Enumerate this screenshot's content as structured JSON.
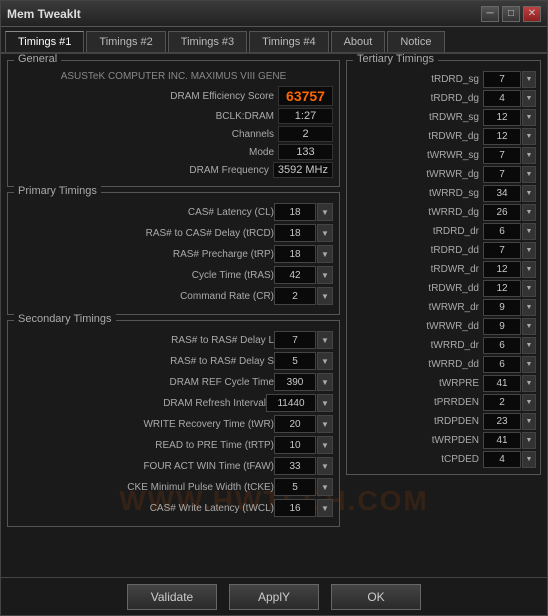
{
  "window": {
    "title": "Mem TweakIt",
    "buttons": {
      "minimize": "─",
      "maximize": "□",
      "close": "✕"
    }
  },
  "tabs": [
    {
      "label": "Timings #1",
      "active": true
    },
    {
      "label": "Timings #2",
      "active": false
    },
    {
      "label": "Timings #3",
      "active": false
    },
    {
      "label": "Timings #4",
      "active": false
    },
    {
      "label": "About",
      "active": false
    },
    {
      "label": "Notice",
      "active": false
    }
  ],
  "general": {
    "label": "General",
    "board": "ASUSTeK COMPUTER INC. MAXIMUS VIII GENE",
    "dram_score_label": "DRAM Efficiency Score",
    "dram_score": "63757",
    "bclk_label": "BCLK:DRAM",
    "bclk_value": "1:27",
    "channels_label": "Channels",
    "channels_value": "2",
    "mode_label": "Mode",
    "mode_value": "133",
    "freq_label": "DRAM Frequency",
    "freq_value": "3592 MHz"
  },
  "primary": {
    "label": "Primary Timings",
    "rows": [
      {
        "label": "CAS# Latency (CL)",
        "value": "18"
      },
      {
        "label": "RAS# to CAS# Delay (tRCD)",
        "value": "18"
      },
      {
        "label": "RAS# Precharge (tRP)",
        "value": "18"
      },
      {
        "label": "Cycle Time (tRAS)",
        "value": "42"
      },
      {
        "label": "Command Rate (CR)",
        "value": "2"
      }
    ]
  },
  "secondary": {
    "label": "Secondary Timings",
    "rows": [
      {
        "label": "RAS# to RAS# Delay L",
        "value": "7"
      },
      {
        "label": "RAS# to RAS# Delay S",
        "value": "5"
      },
      {
        "label": "DRAM REF Cycle Time",
        "value": "390"
      },
      {
        "label": "DRAM Refresh Interval",
        "value": "11440"
      },
      {
        "label": "WRITE Recovery Time (tWR)",
        "value": "20"
      },
      {
        "label": "READ to PRE Time (tRTP)",
        "value": "10"
      },
      {
        "label": "FOUR ACT WIN Time (tFAW)",
        "value": "33"
      },
      {
        "label": "CKE Minimul Pulse Width (tCKE)",
        "value": "5"
      },
      {
        "label": "CAS# Write Latency (tWCL)",
        "value": "16"
      }
    ]
  },
  "tertiary": {
    "label": "Tertiary Timings",
    "rows": [
      {
        "label": "tRDRD_sg",
        "value": "7"
      },
      {
        "label": "tRDRD_dg",
        "value": "4"
      },
      {
        "label": "tRDWR_sg",
        "value": "12"
      },
      {
        "label": "tRDWR_dg",
        "value": "12"
      },
      {
        "label": "tWRWR_sg",
        "value": "7"
      },
      {
        "label": "tWRWR_dg",
        "value": "7"
      },
      {
        "label": "tWRRD_sg",
        "value": "34"
      },
      {
        "label": "tWRRD_dg",
        "value": "26"
      },
      {
        "label": "tRDRD_dr",
        "value": "6"
      },
      {
        "label": "tRDRD_dd",
        "value": "7"
      },
      {
        "label": "tRDWR_dr",
        "value": "12"
      },
      {
        "label": "tRDWR_dd",
        "value": "12"
      },
      {
        "label": "tWRWR_dr",
        "value": "9"
      },
      {
        "label": "tWRWR_dd",
        "value": "9"
      },
      {
        "label": "tWRRD_dr",
        "value": "6"
      },
      {
        "label": "tWRRD_dd",
        "value": "6"
      },
      {
        "label": "tWRPRE",
        "value": "41"
      },
      {
        "label": "tPRRDEN",
        "value": "2"
      },
      {
        "label": "tRDPDEN",
        "value": "23"
      },
      {
        "label": "tWRPDEN",
        "value": "41"
      },
      {
        "label": "tCPDED",
        "value": "4"
      }
    ]
  },
  "footer": {
    "validate_label": "Validate",
    "apply_label": "ApplY",
    "ok_label": "OK"
  },
  "watermark": "WWW.HWTECH.COM"
}
